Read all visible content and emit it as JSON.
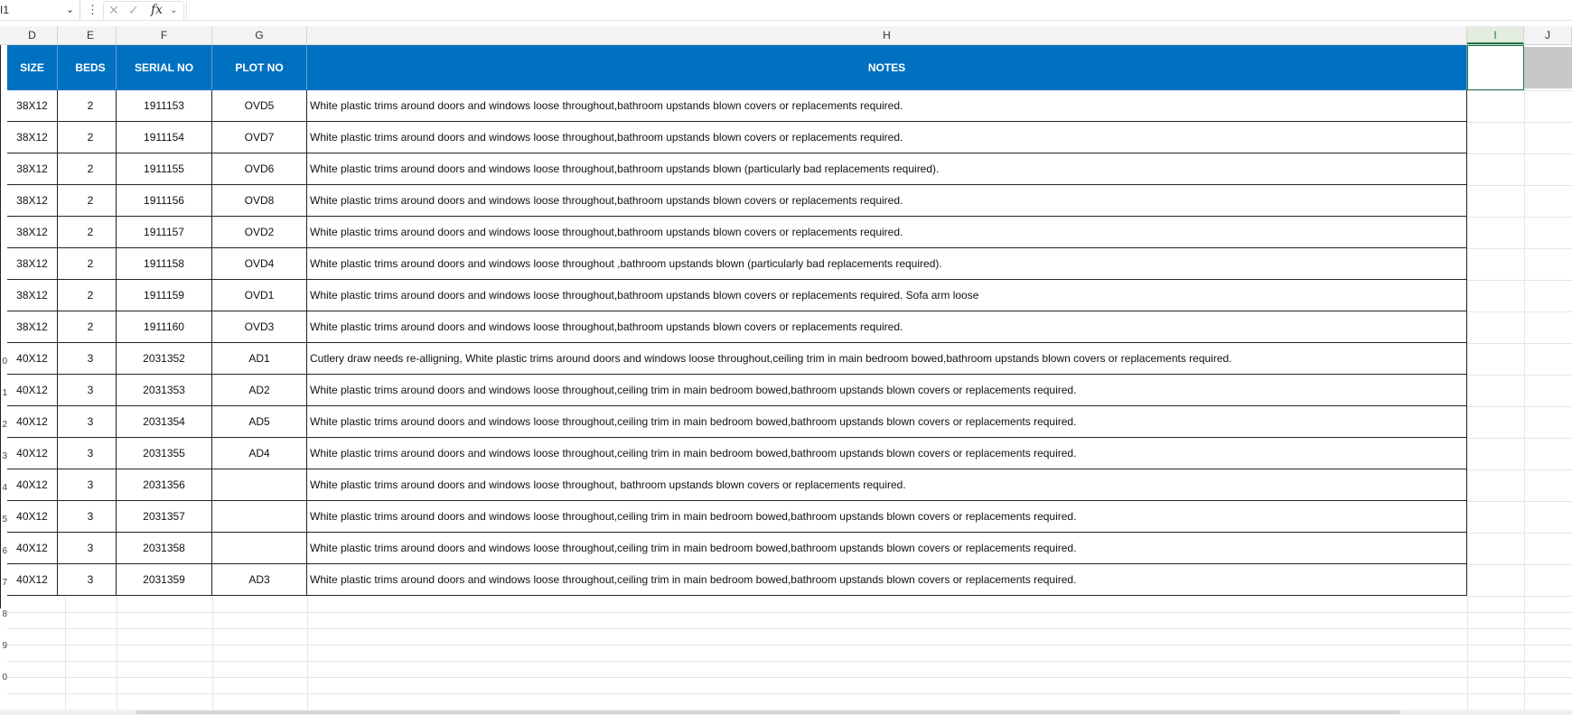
{
  "formula_bar": {
    "name_box": "I1",
    "more_icon": "more-vertical-icon",
    "cancel_icon": "close-icon",
    "enter_icon": "check-icon",
    "fx_label": "fx",
    "formula": ""
  },
  "columns": [
    {
      "letter": "D",
      "selected": false
    },
    {
      "letter": "E",
      "selected": false
    },
    {
      "letter": "F",
      "selected": false
    },
    {
      "letter": "G",
      "selected": false
    },
    {
      "letter": "H",
      "selected": false
    },
    {
      "letter": "I",
      "selected": true
    },
    {
      "letter": "J",
      "selected": false
    }
  ],
  "row_numbers": [
    "0",
    "1",
    "2",
    "3",
    "4",
    "5",
    "6",
    "7",
    "8",
    "9",
    "0"
  ],
  "table": {
    "headers": [
      "SIZE",
      "BEDS",
      "SERIAL NO",
      "PLOT NO",
      "NOTES"
    ],
    "header_color": "#0070c0",
    "rows": [
      {
        "size": "38X12",
        "beds": "2",
        "serial": "1911153",
        "plot": "OVD5",
        "notes": "White plastic trims around doors and windows loose throughout,bathroom upstands blown covers or replacements required."
      },
      {
        "size": "38X12",
        "beds": "2",
        "serial": "1911154",
        "plot": "OVD7",
        "notes": "White plastic trims around doors and windows loose throughout,bathroom upstands blown covers or replacements required."
      },
      {
        "size": "38X12",
        "beds": "2",
        "serial": "1911155",
        "plot": "OVD6",
        "notes": "White plastic trims around doors and windows loose throughout,bathroom upstands blown (particularly bad replacements required)."
      },
      {
        "size": "38X12",
        "beds": "2",
        "serial": "1911156",
        "plot": "OVD8",
        "notes": "White plastic trims around doors and windows loose throughout,bathroom upstands blown covers or replacements required."
      },
      {
        "size": "38X12",
        "beds": "2",
        "serial": "1911157",
        "plot": "OVD2",
        "notes": "White plastic trims around doors and windows loose throughout,bathroom upstands blown covers or replacements required."
      },
      {
        "size": "38X12",
        "beds": "2",
        "serial": "1911158",
        "plot": "OVD4",
        "notes": "White plastic trims around doors and windows loose throughout ,bathroom upstands blown (particularly bad replacements required)."
      },
      {
        "size": "38X12",
        "beds": "2",
        "serial": "1911159",
        "plot": "OVD1",
        "notes": "White plastic trims around doors and windows loose throughout,bathroom upstands blown covers or replacements required. Sofa arm loose"
      },
      {
        "size": "38X12",
        "beds": "2",
        "serial": "1911160",
        "plot": "OVD3",
        "notes": "White plastic trims around doors and windows loose throughout,bathroom upstands blown covers or replacements required."
      },
      {
        "size": "40X12",
        "beds": "3",
        "serial": "2031352",
        "plot": "AD1",
        "notes": "Cutlery draw needs re-alligning, White plastic trims around doors and windows loose throughout,ceiling trim in main bedroom bowed,bathroom upstands blown covers or replacements required."
      },
      {
        "size": "40X12",
        "beds": "3",
        "serial": "2031353",
        "plot": "AD2",
        "notes": "White plastic trims around doors and windows loose throughout,ceiling trim in main bedroom bowed,bathroom upstands blown covers or replacements required."
      },
      {
        "size": "40X12",
        "beds": "3",
        "serial": "2031354",
        "plot": "AD5",
        "notes": "White plastic trims around doors and windows loose throughout,ceiling trim in main bedroom bowed,bathroom upstands blown covers or replacements required."
      },
      {
        "size": "40X12",
        "beds": "3",
        "serial": "2031355",
        "plot": "AD4",
        "notes": "White plastic trims around doors and windows loose throughout,ceiling trim in main bedroom bowed,bathroom upstands blown covers or replacements required."
      },
      {
        "size": "40X12",
        "beds": "3",
        "serial": "2031356",
        "plot": "",
        "notes": "White plastic trims around doors and windows loose throughout, bathroom upstands blown covers or replacements required."
      },
      {
        "size": "40X12",
        "beds": "3",
        "serial": "2031357",
        "plot": "",
        "notes": "White plastic trims around doors and windows loose throughout,ceiling trim in main bedroom bowed,bathroom upstands blown covers or replacements required."
      },
      {
        "size": "40X12",
        "beds": "3",
        "serial": "2031358",
        "plot": "",
        "notes": "White plastic trims around doors and windows loose throughout,ceiling trim in main bedroom bowed,bathroom upstands blown covers or replacements required."
      },
      {
        "size": "40X12",
        "beds": "3",
        "serial": "2031359",
        "plot": "AD3",
        "notes": "White plastic trims around doors and windows loose throughout,ceiling trim in main bedroom bowed,bathroom upstands blown covers or replacements required."
      }
    ]
  }
}
